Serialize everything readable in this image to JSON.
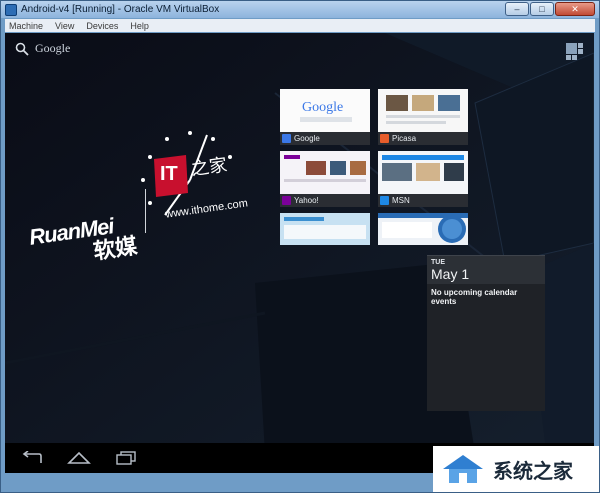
{
  "window": {
    "title": "Android-v4 [Running] - Oracle VM VirtualBox",
    "controls": {
      "minimize": "–",
      "maximize": "□",
      "close": "✕"
    }
  },
  "menubar": {
    "items": [
      "Machine",
      "View",
      "Devices",
      "Help"
    ]
  },
  "android": {
    "search_label": "Google",
    "bookmarks": [
      {
        "name": "Google",
        "favicon_color": "#3b78e7"
      },
      {
        "name": "Picasa",
        "favicon_color": "#e85d2b"
      },
      {
        "name": "Yahoo!",
        "favicon_color": "#7b0099"
      },
      {
        "name": "MSN",
        "favicon_color": "#1e88e5"
      },
      {
        "name": "",
        "favicon_color": "#3a8fd0"
      },
      {
        "name": "",
        "favicon_color": "#2a6cb5"
      }
    ],
    "calendar": {
      "day_of_week": "TUE",
      "date": "May 1",
      "message": "No upcoming calendar events"
    }
  },
  "watermark": {
    "brand_latin": "RuanMei",
    "brand_chinese": "软媒",
    "it_logo": "IT",
    "it_chinese": "之家",
    "url": "www.ithome.com"
  },
  "corner_watermark": {
    "text": "系统之家"
  },
  "colors": {
    "accent": "#c8102e",
    "screen_bg": "#05060c",
    "frame": "#6f9cc6"
  }
}
